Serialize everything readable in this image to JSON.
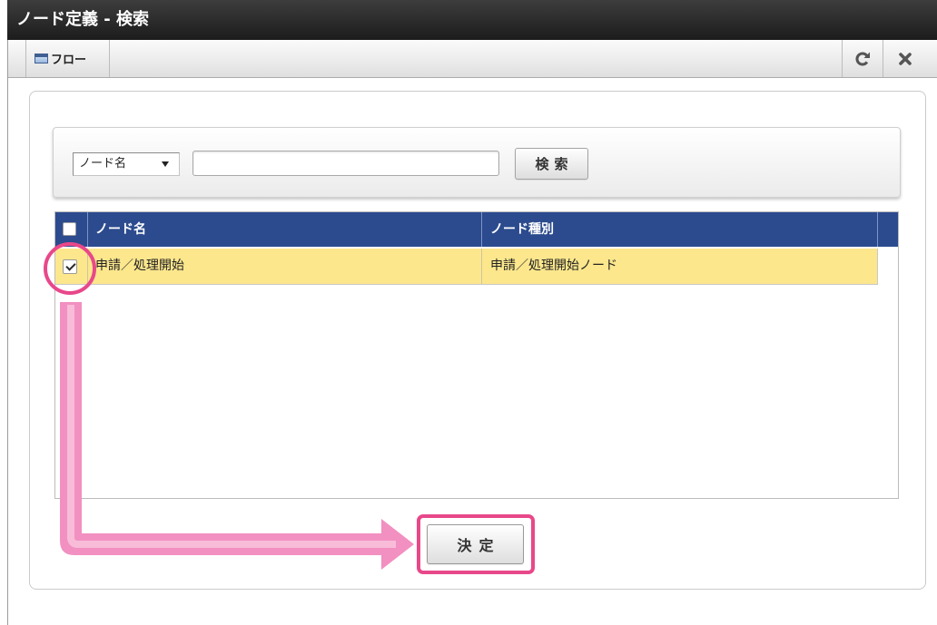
{
  "window": {
    "title": "ノード定義 - 検索"
  },
  "toolbar": {
    "tabs": [
      {
        "label": "フロー",
        "icon": "window-icon"
      }
    ],
    "refresh_icon": "refresh-icon",
    "close_icon": "close-icon"
  },
  "search": {
    "field_select": {
      "selected": "ノード名",
      "icon": "chevron-down-icon"
    },
    "keyword": {
      "value": ""
    },
    "button_label": "検索"
  },
  "table": {
    "select_all_checked": false,
    "columns": [
      "ノード名",
      "ノード種別"
    ],
    "rows": [
      {
        "checked": true,
        "highlighted": true,
        "cells": [
          "申請／処理開始",
          "申請／処理開始ノード"
        ]
      }
    ]
  },
  "footer": {
    "confirm_label": "決定"
  },
  "colors": {
    "title_bar": "#1c1c1c",
    "table_header": "#2c4b8e",
    "selected_row": "#fce78d",
    "annotation_pink": "#e8488a",
    "arrow_pink": "#f290c1"
  }
}
